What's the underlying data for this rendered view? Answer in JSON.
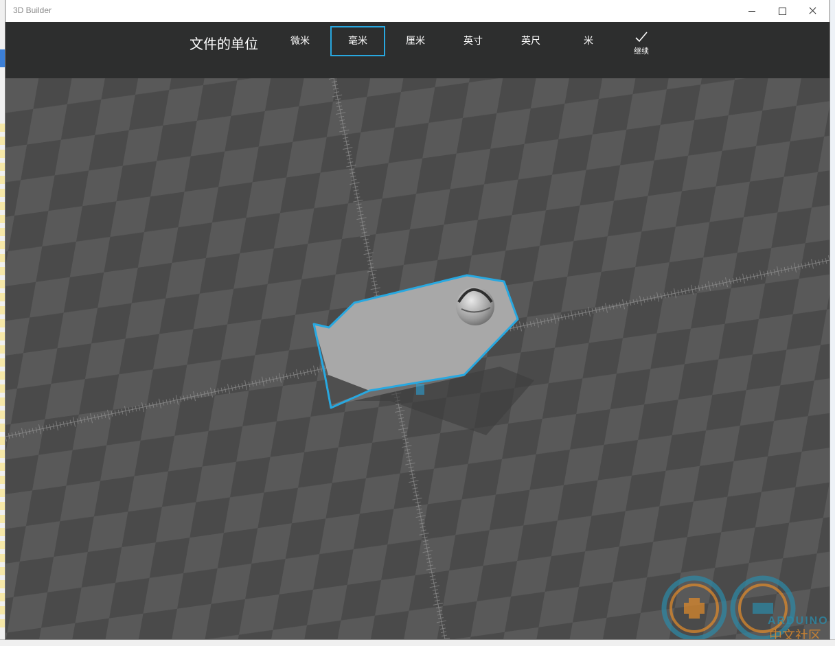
{
  "window": {
    "app_title": "3D Builder"
  },
  "toolbar": {
    "title": "文件的单位",
    "units": [
      {
        "label": "微米",
        "selected": false
      },
      {
        "label": "毫米",
        "selected": true
      },
      {
        "label": "厘米",
        "selected": false
      },
      {
        "label": "英寸",
        "selected": false
      },
      {
        "label": "英尺",
        "selected": false
      },
      {
        "label": "米",
        "selected": false
      }
    ],
    "continue_label": "继续"
  },
  "watermark": {
    "brand": "ARDUINO",
    "community": "中文社区"
  },
  "colors": {
    "accent": "#28a8e0",
    "toolbar_bg": "#2d2e2e",
    "grid_dark": "#4a4a4a",
    "grid_light": "#565656"
  }
}
